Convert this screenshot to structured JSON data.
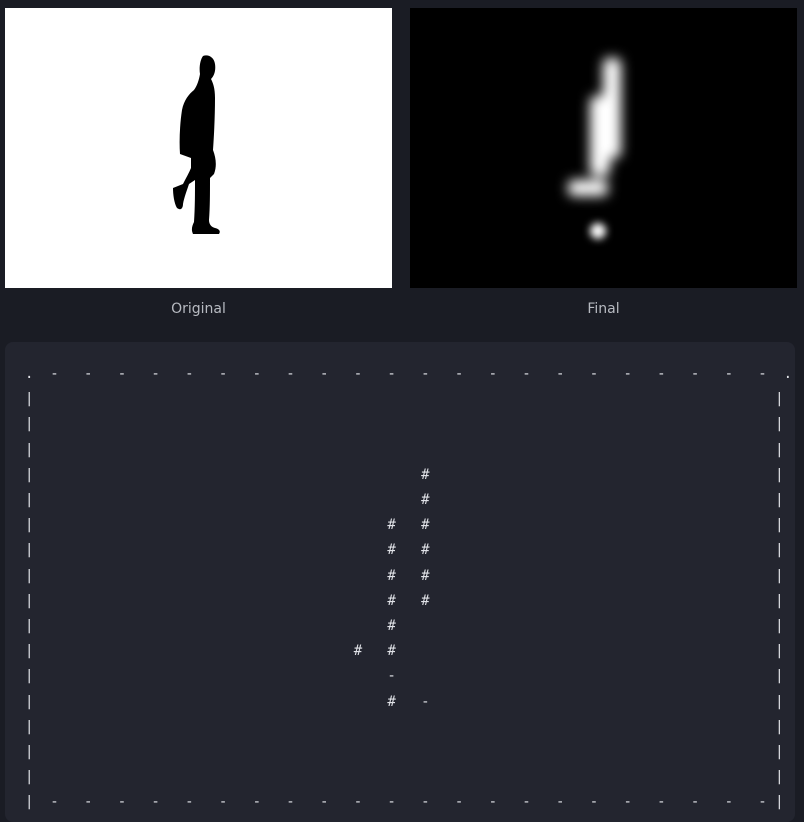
{
  "images": [
    {
      "caption": "Original",
      "icon": "walking-silhouette-image",
      "background": "#ffffff"
    },
    {
      "caption": "Final",
      "icon": "blurred-exclamation-image",
      "background": "#000000"
    }
  ],
  "ascii_art": ".  -   -   -   -   -   -   -   -   -   -   -   -   -   -   -   -   -   -   -   -   -   -  .\n|                                                                                        |\n|                                                                                        |\n|                                                                                        |\n|                                              #                                         |\n|                                              #                                         |\n|                                          #   #                                         |\n|                                          #   #                                         |\n|                                          #   #                                         |\n|                                          #   #                                         |\n|                                          #                                             |\n|                                      #   #                                             |\n|                                          -                                             |\n|                                          #   -                                         |\n|                                                                                        |\n|                                                                                        |\n|                                                                                        |\n|  -   -   -   -   -   -   -   -   -   -   -   -   -   -   -   -   -   -   -   -   -   - |",
  "colors": {
    "background": "#1a1c24",
    "panel": "#23252f",
    "text": "#e0e2e7",
    "caption": "#b7bac1"
  }
}
